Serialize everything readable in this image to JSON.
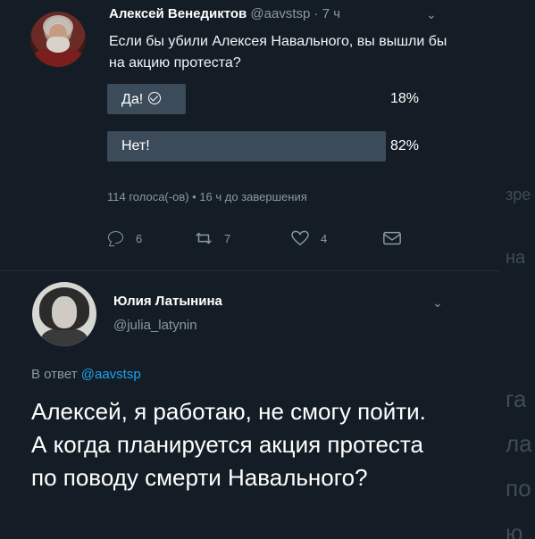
{
  "tweet1": {
    "author_name": "Алексей Венедиктов",
    "handle": "@aavstsp",
    "separator": " · ",
    "time": "7 ч",
    "text": "Если бы убили Алексея Навального, вы вышли бы на акцию протеста?",
    "poll": {
      "options": [
        {
          "label": "Да!",
          "percent": "18%",
          "share": 0.18,
          "voted": true
        },
        {
          "label": "Нет!",
          "percent": "82%",
          "share": 0.82,
          "voted": false
        }
      ],
      "meta": "114 голоса(-ов) • 16 ч до завершения"
    },
    "actions": {
      "replies": "6",
      "retweets": "7",
      "likes": "4"
    }
  },
  "tweet2": {
    "author_name": "Юлия Латынина",
    "handle": "@julia_latynin",
    "reply_prefix": "В ответ ",
    "reply_mention": "@aavstsp",
    "text": "Алексей, я работаю, не смогу пойти. А когда планируется акция протеста по поводу смерти Навального?"
  },
  "background_fragments": [
    "зре",
    "на",
    "га",
    "ла",
    "по",
    "ю"
  ],
  "colors": {
    "background": "#141d26",
    "poll_fill": "#3b4b5a",
    "secondary_text": "#8899a6",
    "mention": "#1da1f2"
  },
  "icons": [
    "chevron-down-icon",
    "reply-icon",
    "retweet-icon",
    "like-icon",
    "direct-message-icon",
    "checkmark-icon"
  ]
}
